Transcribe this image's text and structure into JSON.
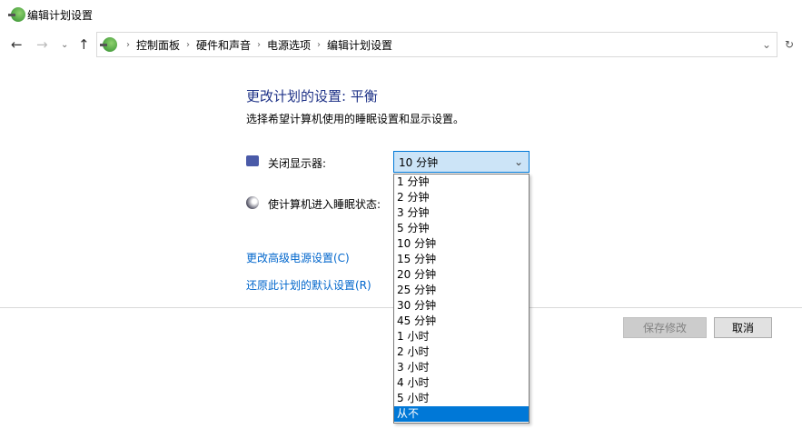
{
  "window": {
    "title": "编辑计划设置"
  },
  "address": {
    "crumbs": [
      "控制面板",
      "硬件和声音",
      "电源选项",
      "编辑计划设置"
    ]
  },
  "main": {
    "heading": "更改计划的设置: 平衡",
    "subtitle": "选择希望计算机使用的睡眠设置和显示设置。",
    "display_label": "关闭显示器:",
    "sleep_label": "使计算机进入睡眠状态:",
    "display_value": "10 分钟",
    "options": [
      "1 分钟",
      "2 分钟",
      "3 分钟",
      "5 分钟",
      "10 分钟",
      "15 分钟",
      "20 分钟",
      "25 分钟",
      "30 分钟",
      "45 分钟",
      "1 小时",
      "2 小时",
      "3 小时",
      "4 小时",
      "5 小时",
      "从不"
    ],
    "highlighted_option": "从不",
    "link_advanced": "更改高级电源设置(C)",
    "link_restore": "还原此计划的默认设置(R)",
    "save_label": "保存修改",
    "cancel_label": "取消"
  },
  "colors": {
    "accent": "#0078d7",
    "link": "#0066cc",
    "heading": "#1e3287"
  }
}
